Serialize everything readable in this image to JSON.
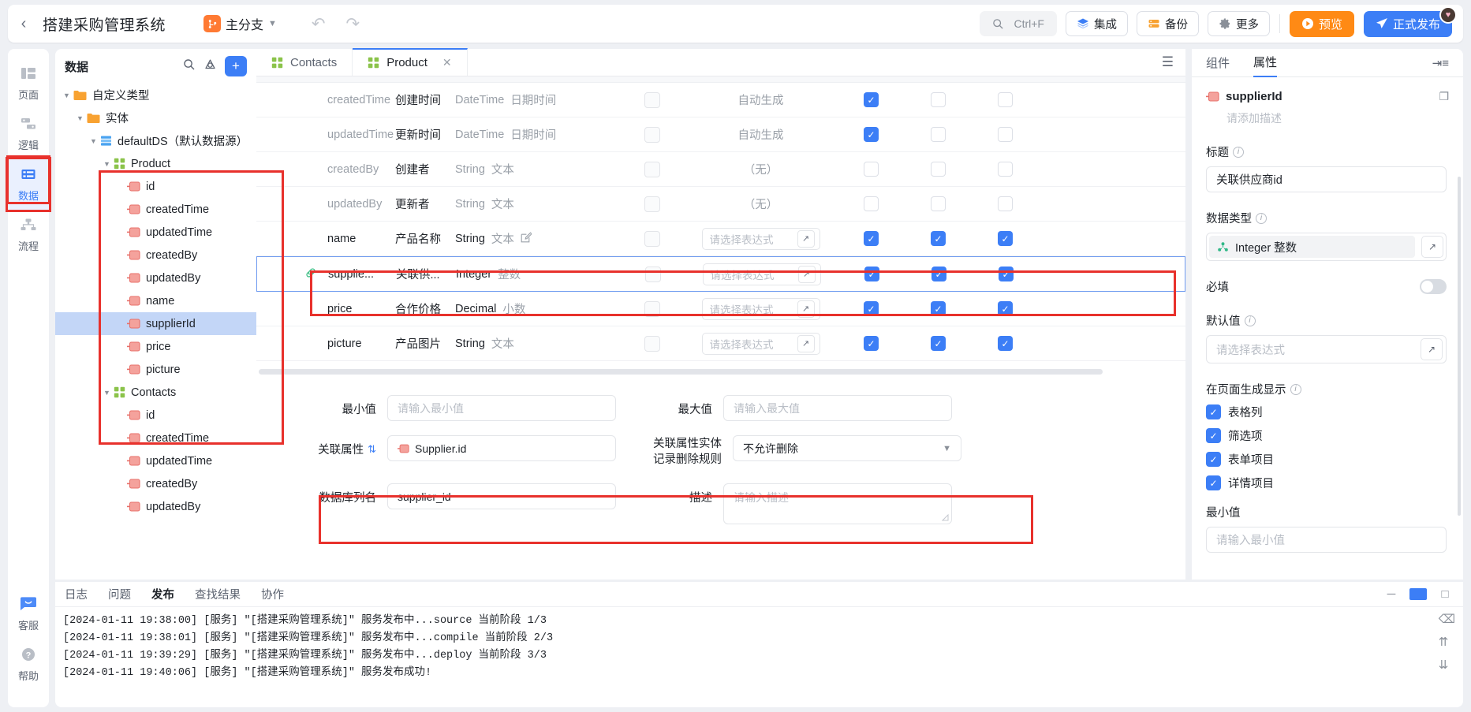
{
  "topbar": {
    "back_icon": "chevron-left-icon",
    "title": "搭建采购管理系统",
    "branch": "主分支",
    "search_placeholder": "Ctrl+F",
    "buttons": [
      {
        "label": "集成",
        "icon": "layers-icon"
      },
      {
        "label": "备份",
        "icon": "database-icon"
      },
      {
        "label": "更多",
        "icon": "gear-icon"
      }
    ],
    "preview": "预览",
    "publish": "正式发布"
  },
  "rail": {
    "items": [
      {
        "label": "页面",
        "icon": "layout-icon",
        "active": false
      },
      {
        "label": "逻辑",
        "icon": "logic-icon",
        "active": false
      },
      {
        "label": "数据",
        "icon": "data-icon",
        "active": true
      },
      {
        "label": "流程",
        "icon": "flow-icon",
        "active": false
      }
    ],
    "bottom": [
      {
        "label": "客服",
        "icon": "chat-icon"
      },
      {
        "label": "帮助",
        "icon": "question-icon"
      }
    ]
  },
  "tree": {
    "title": "数据",
    "nodes": [
      {
        "label": "自定义类型",
        "type": "folder",
        "indent": 0
      },
      {
        "label": "实体",
        "type": "folder",
        "indent": 1
      },
      {
        "label": "defaultDS（默认数据源）",
        "type": "datasource",
        "indent": 2
      },
      {
        "label": "Product",
        "type": "entity",
        "indent": 3
      },
      {
        "label": "id",
        "type": "field",
        "indent": 4
      },
      {
        "label": "createdTime",
        "type": "field",
        "indent": 4
      },
      {
        "label": "updatedTime",
        "type": "field",
        "indent": 4
      },
      {
        "label": "createdBy",
        "type": "field",
        "indent": 4
      },
      {
        "label": "updatedBy",
        "type": "field",
        "indent": 4
      },
      {
        "label": "name",
        "type": "field",
        "indent": 4
      },
      {
        "label": "supplierId",
        "type": "field",
        "indent": 4,
        "selected": true
      },
      {
        "label": "price",
        "type": "field",
        "indent": 4
      },
      {
        "label": "picture",
        "type": "field",
        "indent": 4
      },
      {
        "label": "Contacts",
        "type": "entity",
        "indent": 3
      },
      {
        "label": "id",
        "type": "field",
        "indent": 4
      },
      {
        "label": "createdTime",
        "type": "field",
        "indent": 4
      },
      {
        "label": "updatedTime",
        "type": "field",
        "indent": 4
      },
      {
        "label": "createdBy",
        "type": "field",
        "indent": 4
      },
      {
        "label": "updatedBy",
        "type": "field",
        "indent": 4
      }
    ]
  },
  "tabs": [
    {
      "label": "Contacts",
      "active": false,
      "closable": false
    },
    {
      "label": "Product",
      "active": true,
      "closable": true
    }
  ],
  "table": {
    "expr_placeholder": "请选择表达式",
    "rows": [
      {
        "name": "createdTime",
        "label": "创建时间",
        "type": "DateTime",
        "type_cn": "日期时间",
        "required": false,
        "default_text": "自动生成",
        "default_is_input": false,
        "k1": true,
        "k2": false,
        "k3": false,
        "dim": true,
        "link": false,
        "edit": false
      },
      {
        "name": "updatedTime",
        "label": "更新时间",
        "type": "DateTime",
        "type_cn": "日期时间",
        "required": false,
        "default_text": "自动生成",
        "default_is_input": false,
        "k1": true,
        "k2": false,
        "k3": false,
        "dim": true,
        "link": false,
        "edit": false
      },
      {
        "name": "createdBy",
        "label": "创建者",
        "type": "String",
        "type_cn": "文本",
        "required": false,
        "default_text": "（无）",
        "default_is_input": false,
        "k1": false,
        "k2": false,
        "k3": false,
        "dim": true,
        "link": false,
        "edit": false
      },
      {
        "name": "updatedBy",
        "label": "更新者",
        "type": "String",
        "type_cn": "文本",
        "required": false,
        "default_text": "（无）",
        "default_is_input": false,
        "k1": false,
        "k2": false,
        "k3": false,
        "dim": true,
        "link": false,
        "edit": false
      },
      {
        "name": "name",
        "label": "产品名称",
        "type": "String",
        "type_cn": "文本",
        "required": false,
        "default_text": "请选择表达式",
        "default_is_input": true,
        "k1": true,
        "k2": true,
        "k3": true,
        "dim": false,
        "link": false,
        "edit": true
      },
      {
        "name": "supplie...",
        "label": "关联供...",
        "type": "Integer",
        "type_cn": "整数",
        "required": false,
        "default_text": "请选择表达式",
        "default_is_input": true,
        "k1": true,
        "k2": true,
        "k3": true,
        "dim": false,
        "link": true,
        "edit": false,
        "highlight": true
      },
      {
        "name": "price",
        "label": "合作价格",
        "type": "Decimal",
        "type_cn": "小数",
        "required": false,
        "default_text": "请选择表达式",
        "default_is_input": true,
        "k1": true,
        "k2": true,
        "k3": true,
        "dim": false,
        "link": false,
        "edit": false
      },
      {
        "name": "picture",
        "label": "产品图片",
        "type": "String",
        "type_cn": "文本",
        "required": false,
        "default_text": "请选择表达式",
        "default_is_input": true,
        "k1": true,
        "k2": true,
        "k3": true,
        "dim": false,
        "link": false,
        "edit": false
      }
    ]
  },
  "form": {
    "min_label": "最小值",
    "min_placeholder": "请输入最小值",
    "max_label": "最大值",
    "max_placeholder": "请输入最大值",
    "relation_label": "关联属性",
    "relation_value": "Supplier.id",
    "delete_rule_label": "关联属性实体\n记录删除规则",
    "delete_rule_label_1": "关联属性实体",
    "delete_rule_label_2": "记录删除规则",
    "delete_rule_value": "不允许删除",
    "column_label": "数据库列名",
    "column_value": "supplier_id",
    "desc_label": "描述",
    "desc_placeholder": "请输入描述"
  },
  "right": {
    "tabs": [
      {
        "label": "组件",
        "active": false
      },
      {
        "label": "属性",
        "active": true
      }
    ],
    "field_name": "supplierId",
    "field_desc_placeholder": "请添加描述",
    "title_label": "标题",
    "title_value": "关联供应商id",
    "datatype_label": "数据类型",
    "datatype_value": "Integer 整数",
    "required_label": "必填",
    "required_on": false,
    "default_label": "默认值",
    "default_placeholder": "请选择表达式",
    "display_label": "在页面生成显示",
    "display_options": [
      {
        "label": "表格列",
        "checked": true
      },
      {
        "label": "筛选项",
        "checked": true
      },
      {
        "label": "表单项目",
        "checked": true
      },
      {
        "label": "详情项目",
        "checked": true
      }
    ],
    "min_label": "最小值",
    "min_placeholder": "请输入最小值"
  },
  "console": {
    "tabs": [
      {
        "label": "日志",
        "active": false
      },
      {
        "label": "问题",
        "active": false
      },
      {
        "label": "发布",
        "active": true
      },
      {
        "label": "查找结果",
        "active": false
      },
      {
        "label": "协作",
        "active": false
      }
    ],
    "logs": [
      "[2024-01-11 19:38:00] [服务] \"[搭建采购管理系统]\" 服务发布中...source 当前阶段 1/3",
      "[2024-01-11 19:38:01] [服务] \"[搭建采购管理系统]\" 服务发布中...compile 当前阶段 2/3",
      "[2024-01-11 19:39:29] [服务] \"[搭建采购管理系统]\" 服务发布中...deploy 当前阶段 3/3",
      "[2024-01-11 19:40:06] [服务] \"[搭建采购管理系统]\" 服务发布成功!"
    ]
  },
  "colors": {
    "accent": "#3c7ef6",
    "preview": "#ff8a15",
    "annotation": "#e8312c",
    "field": "#f08a84",
    "entity": "#8bc34a"
  }
}
